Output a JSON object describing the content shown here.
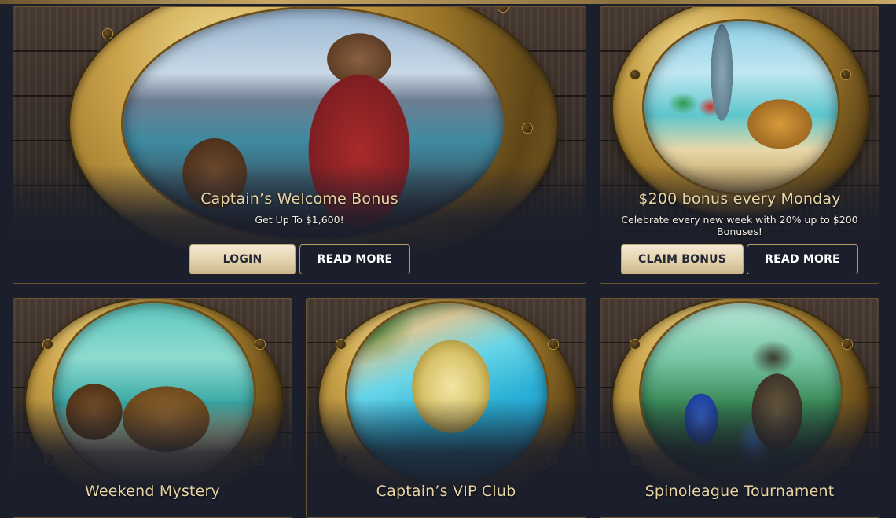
{
  "promos": [
    {
      "title": "Captain’s Welcome Bonus",
      "subtitle": "Get Up To $1,600!",
      "buttons": {
        "primary": "LOGIN",
        "secondary": "READ MORE"
      }
    },
    {
      "title": "$200 bonus every Monday",
      "subtitle": "Celebrate every new week with 20% up to $200 Bonuses!",
      "buttons": {
        "primary": "CLAIM BONUS",
        "secondary": "READ MORE"
      }
    },
    {
      "title": "Weekend Mystery"
    },
    {
      "title": "Captain’s VIP Club"
    },
    {
      "title": "Spinoleague Tournament"
    }
  ],
  "colors": {
    "page_bg": "#1b1e2b",
    "title_gold": "#e8d5a6",
    "button_light": "#e8dbc0",
    "button_border": "#b99a62",
    "card_border": "#6e5530"
  },
  "icons": [
    "porthole-frame",
    "pirate-artwork",
    "treasure-artwork",
    "balloon-artwork",
    "explorer-artwork"
  ]
}
